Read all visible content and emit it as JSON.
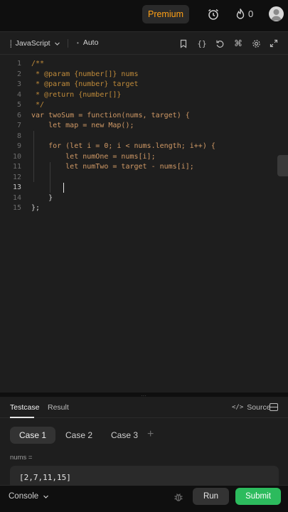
{
  "topbar": {
    "premium_label": "Premium",
    "streak_count": "0",
    "icons": [
      "alarm-icon",
      "fire-icon",
      "avatar"
    ]
  },
  "editor": {
    "language": "JavaScript",
    "mode": "Auto",
    "toolbar_icons": [
      "bookmark-icon",
      "braces-icon",
      "reset-icon",
      "command-icon",
      "settings-icon",
      "expand-icon"
    ],
    "active_line": 13,
    "lines": [
      {
        "n": "1",
        "t": "/**"
      },
      {
        "n": "2",
        "t": " * @param {number[]} nums"
      },
      {
        "n": "3",
        "t": " * @param {number} target"
      },
      {
        "n": "4",
        "t": " * @return {number[]}"
      },
      {
        "n": "5",
        "t": " */"
      },
      {
        "n": "6",
        "t": "var twoSum = function(nums, target) {"
      },
      {
        "n": "7",
        "t": "    let map = new Map();"
      },
      {
        "n": "8",
        "t": ""
      },
      {
        "n": "9",
        "t": "    for (let i = 0; i < nums.length; i++) {"
      },
      {
        "n": "10",
        "t": "        let numOne = nums[i];"
      },
      {
        "n": "11",
        "t": "        let numTwo = target - nums[i];"
      },
      {
        "n": "12",
        "t": ""
      },
      {
        "n": "13",
        "t": ""
      },
      {
        "n": "14",
        "t": "    }"
      },
      {
        "n": "15",
        "t": "};"
      }
    ]
  },
  "bottom": {
    "tabs": [
      "Testcase",
      "Result"
    ],
    "active_tab": "Testcase",
    "source_label": "Source",
    "cases": [
      "Case 1",
      "Case 2",
      "Case 3"
    ],
    "active_case": "Case 1",
    "add_case": "+",
    "param_label": "nums =",
    "param_value": "[2,7,11,15]"
  },
  "footer": {
    "console_label": "Console",
    "run_label": "Run",
    "submit_label": "Submit"
  },
  "colors": {
    "accent_premium": "#ffa116",
    "submit_green": "#2cbb5d",
    "background": "#0f0f0f",
    "panel": "#1e1e1e"
  }
}
